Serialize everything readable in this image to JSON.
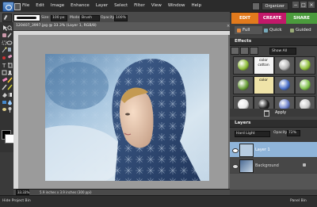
{
  "menubar": {
    "items": [
      "File",
      "Edit",
      "Image",
      "Enhance",
      "Layer",
      "Select",
      "Filter",
      "View",
      "Window",
      "Help"
    ],
    "organizer_label": "Organizer",
    "window_controls": [
      "−",
      "□",
      "×"
    ]
  },
  "options": {
    "size_label": "Size:",
    "size_value": "100 px",
    "mode_label": "Mode:",
    "mode_value": "Brush",
    "opacity_label": "Opacity:",
    "opacity_value": "100%"
  },
  "mode_tabs": {
    "edit": "EDIT",
    "create": "CREATE",
    "share": "SHARE"
  },
  "edit_subtabs": {
    "full": "Full",
    "quick": "Quick",
    "guided": "Guided"
  },
  "document": {
    "title": "120407_3997.jpg @ 33.3% (Layer 1, RGB/8)",
    "close": "×",
    "zoom": "33.33%",
    "info": "5.9 inches x 3.9 inches (300 ppi)"
  },
  "effects": {
    "title": "Effects",
    "filter_value": "Show All",
    "apply_label": "Apply",
    "thumbs": [
      {
        "kind": "ball",
        "color": "#8fbf3a"
      },
      {
        "kind": "text",
        "text": "color cotton",
        "bg": "#f4f4f4"
      },
      {
        "kind": "ball",
        "color": "#b6b6b6"
      },
      {
        "kind": "ball",
        "color": "#8fbf3a"
      },
      {
        "kind": "ball",
        "color": "#6aa03a"
      },
      {
        "kind": "text",
        "text": "color",
        "bg": "#efe3a8"
      },
      {
        "kind": "ball",
        "color": "#4a6fc9"
      },
      {
        "kind": "ball",
        "color": "#7fc04a"
      },
      {
        "kind": "ball",
        "color": "#e8e8e8"
      },
      {
        "kind": "ball",
        "color": "#222222"
      },
      {
        "kind": "ball",
        "color": "#6b7fc9"
      },
      {
        "kind": "ball",
        "color": "#c9c9c9"
      }
    ]
  },
  "layers": {
    "title": "Layers",
    "blend_mode": "Hard Light",
    "opacity_label": "Opacity:",
    "opacity_value": "72%",
    "items": [
      {
        "name": "Layer 1",
        "selected": true
      },
      {
        "name": "Background",
        "selected": false
      }
    ]
  },
  "bottom": {
    "hide_bin": "Hide Project Bin",
    "panel_bin": "Panel Bin"
  },
  "colors": {
    "edit": "#e27a1c",
    "create": "#c2186a",
    "share": "#4b9b3c",
    "selected_layer": "#8fb4d9"
  }
}
